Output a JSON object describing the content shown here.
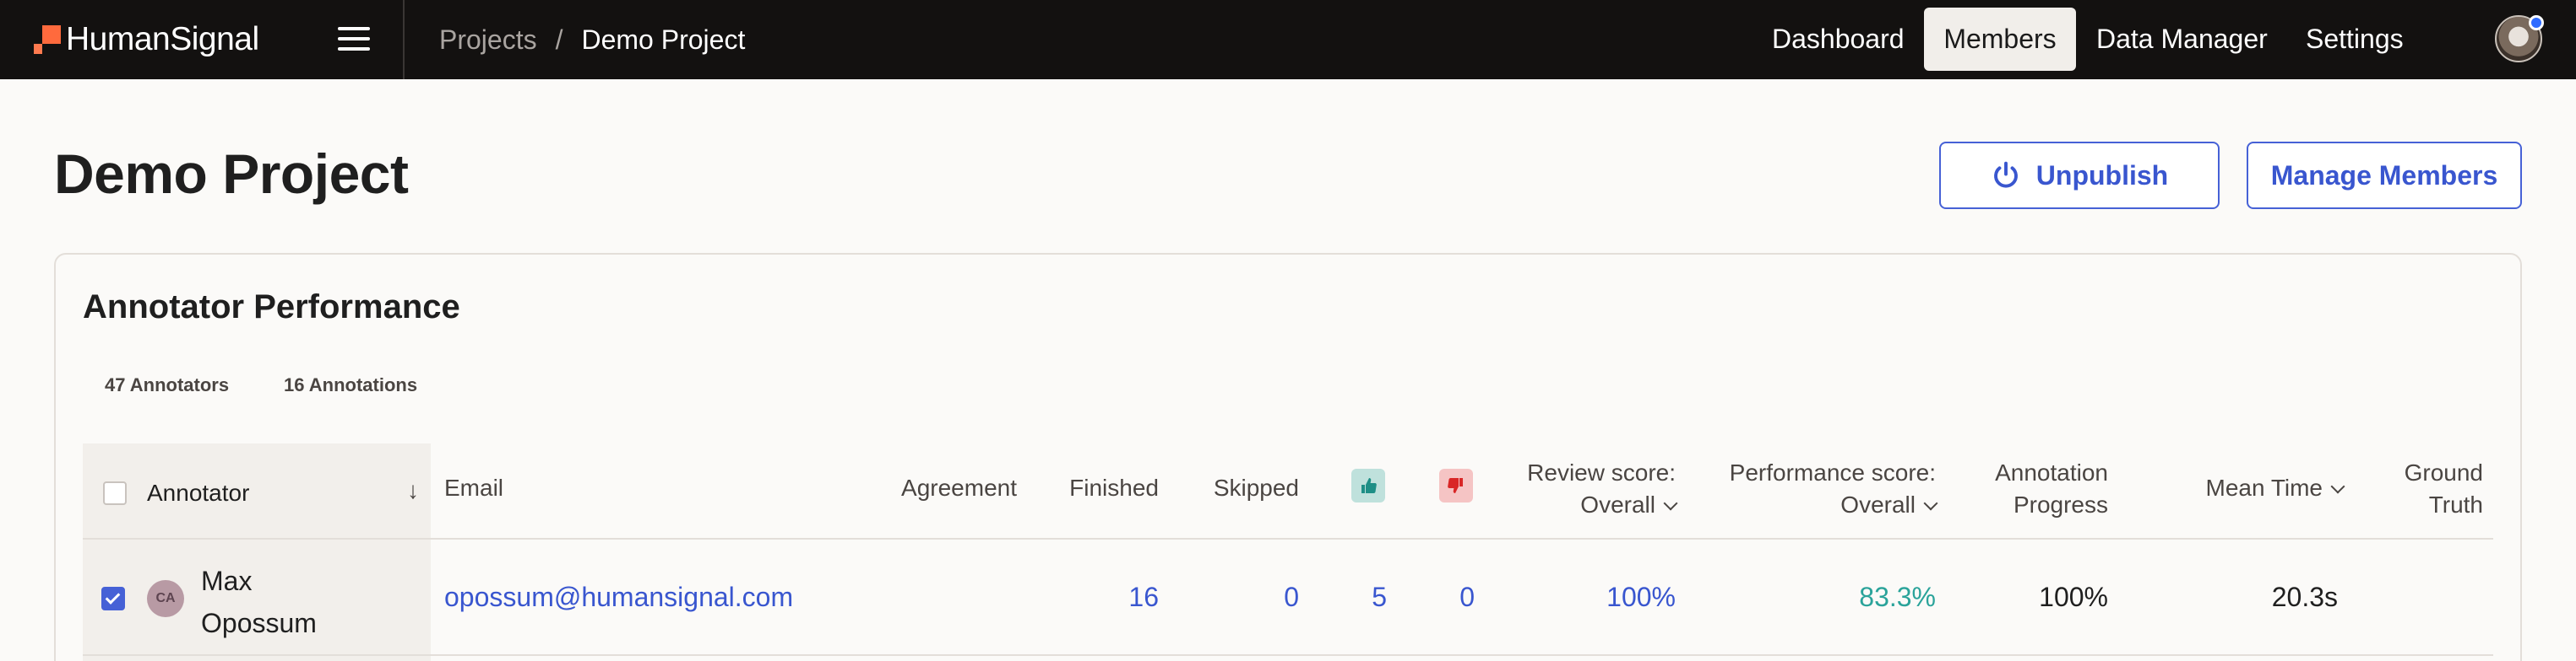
{
  "topbar": {
    "brand": "HumanSignal",
    "breadcrumb": {
      "parent": "Projects",
      "separator": "/",
      "current": "Demo Project"
    },
    "nav": {
      "dashboard": "Dashboard",
      "members": "Members",
      "data_manager": "Data Manager",
      "settings": "Settings"
    }
  },
  "header": {
    "title": "Demo Project",
    "unpublish_label": "Unpublish",
    "manage_members_label": "Manage Members"
  },
  "performance": {
    "title": "Annotator Performance",
    "stats": {
      "annotators": "47 Annotators",
      "annotations": "16 Annotations"
    },
    "columns": {
      "annotator": "Annotator",
      "email": "Email",
      "agreement": "Agreement",
      "finished": "Finished",
      "skipped": "Skipped",
      "review_score_line1": "Review score:",
      "review_score_line2": "Overall",
      "performance_score_line1": "Performance score:",
      "performance_score_line2": "Overall",
      "annotation_progress_line1": "Annotation",
      "annotation_progress_line2": "Progress",
      "mean_time": "Mean Time",
      "ground_truth_line1": "Ground",
      "ground_truth_line2": "Truth"
    },
    "rows": [
      {
        "initials": "CA",
        "name": "Max Opossum",
        "email": "opossum@humansignal.com",
        "finished": "16",
        "skipped": "0",
        "thumbs_up": "5",
        "thumbs_down": "0",
        "review_score": "100%",
        "performance_score": "83.3%",
        "annotation_progress": "100%",
        "mean_time": "20.3s",
        "selected": true
      }
    ]
  },
  "colors": {
    "accent": "#4661d6",
    "positive": "#2aa39a",
    "brand": "#ff6a3d",
    "topbar": "#131110"
  },
  "icons": [
    "logo-icon",
    "hamburger-icon",
    "power-icon",
    "sort-down-icon",
    "thumbs-up-icon",
    "thumbs-down-icon",
    "chevron-down-icon"
  ]
}
